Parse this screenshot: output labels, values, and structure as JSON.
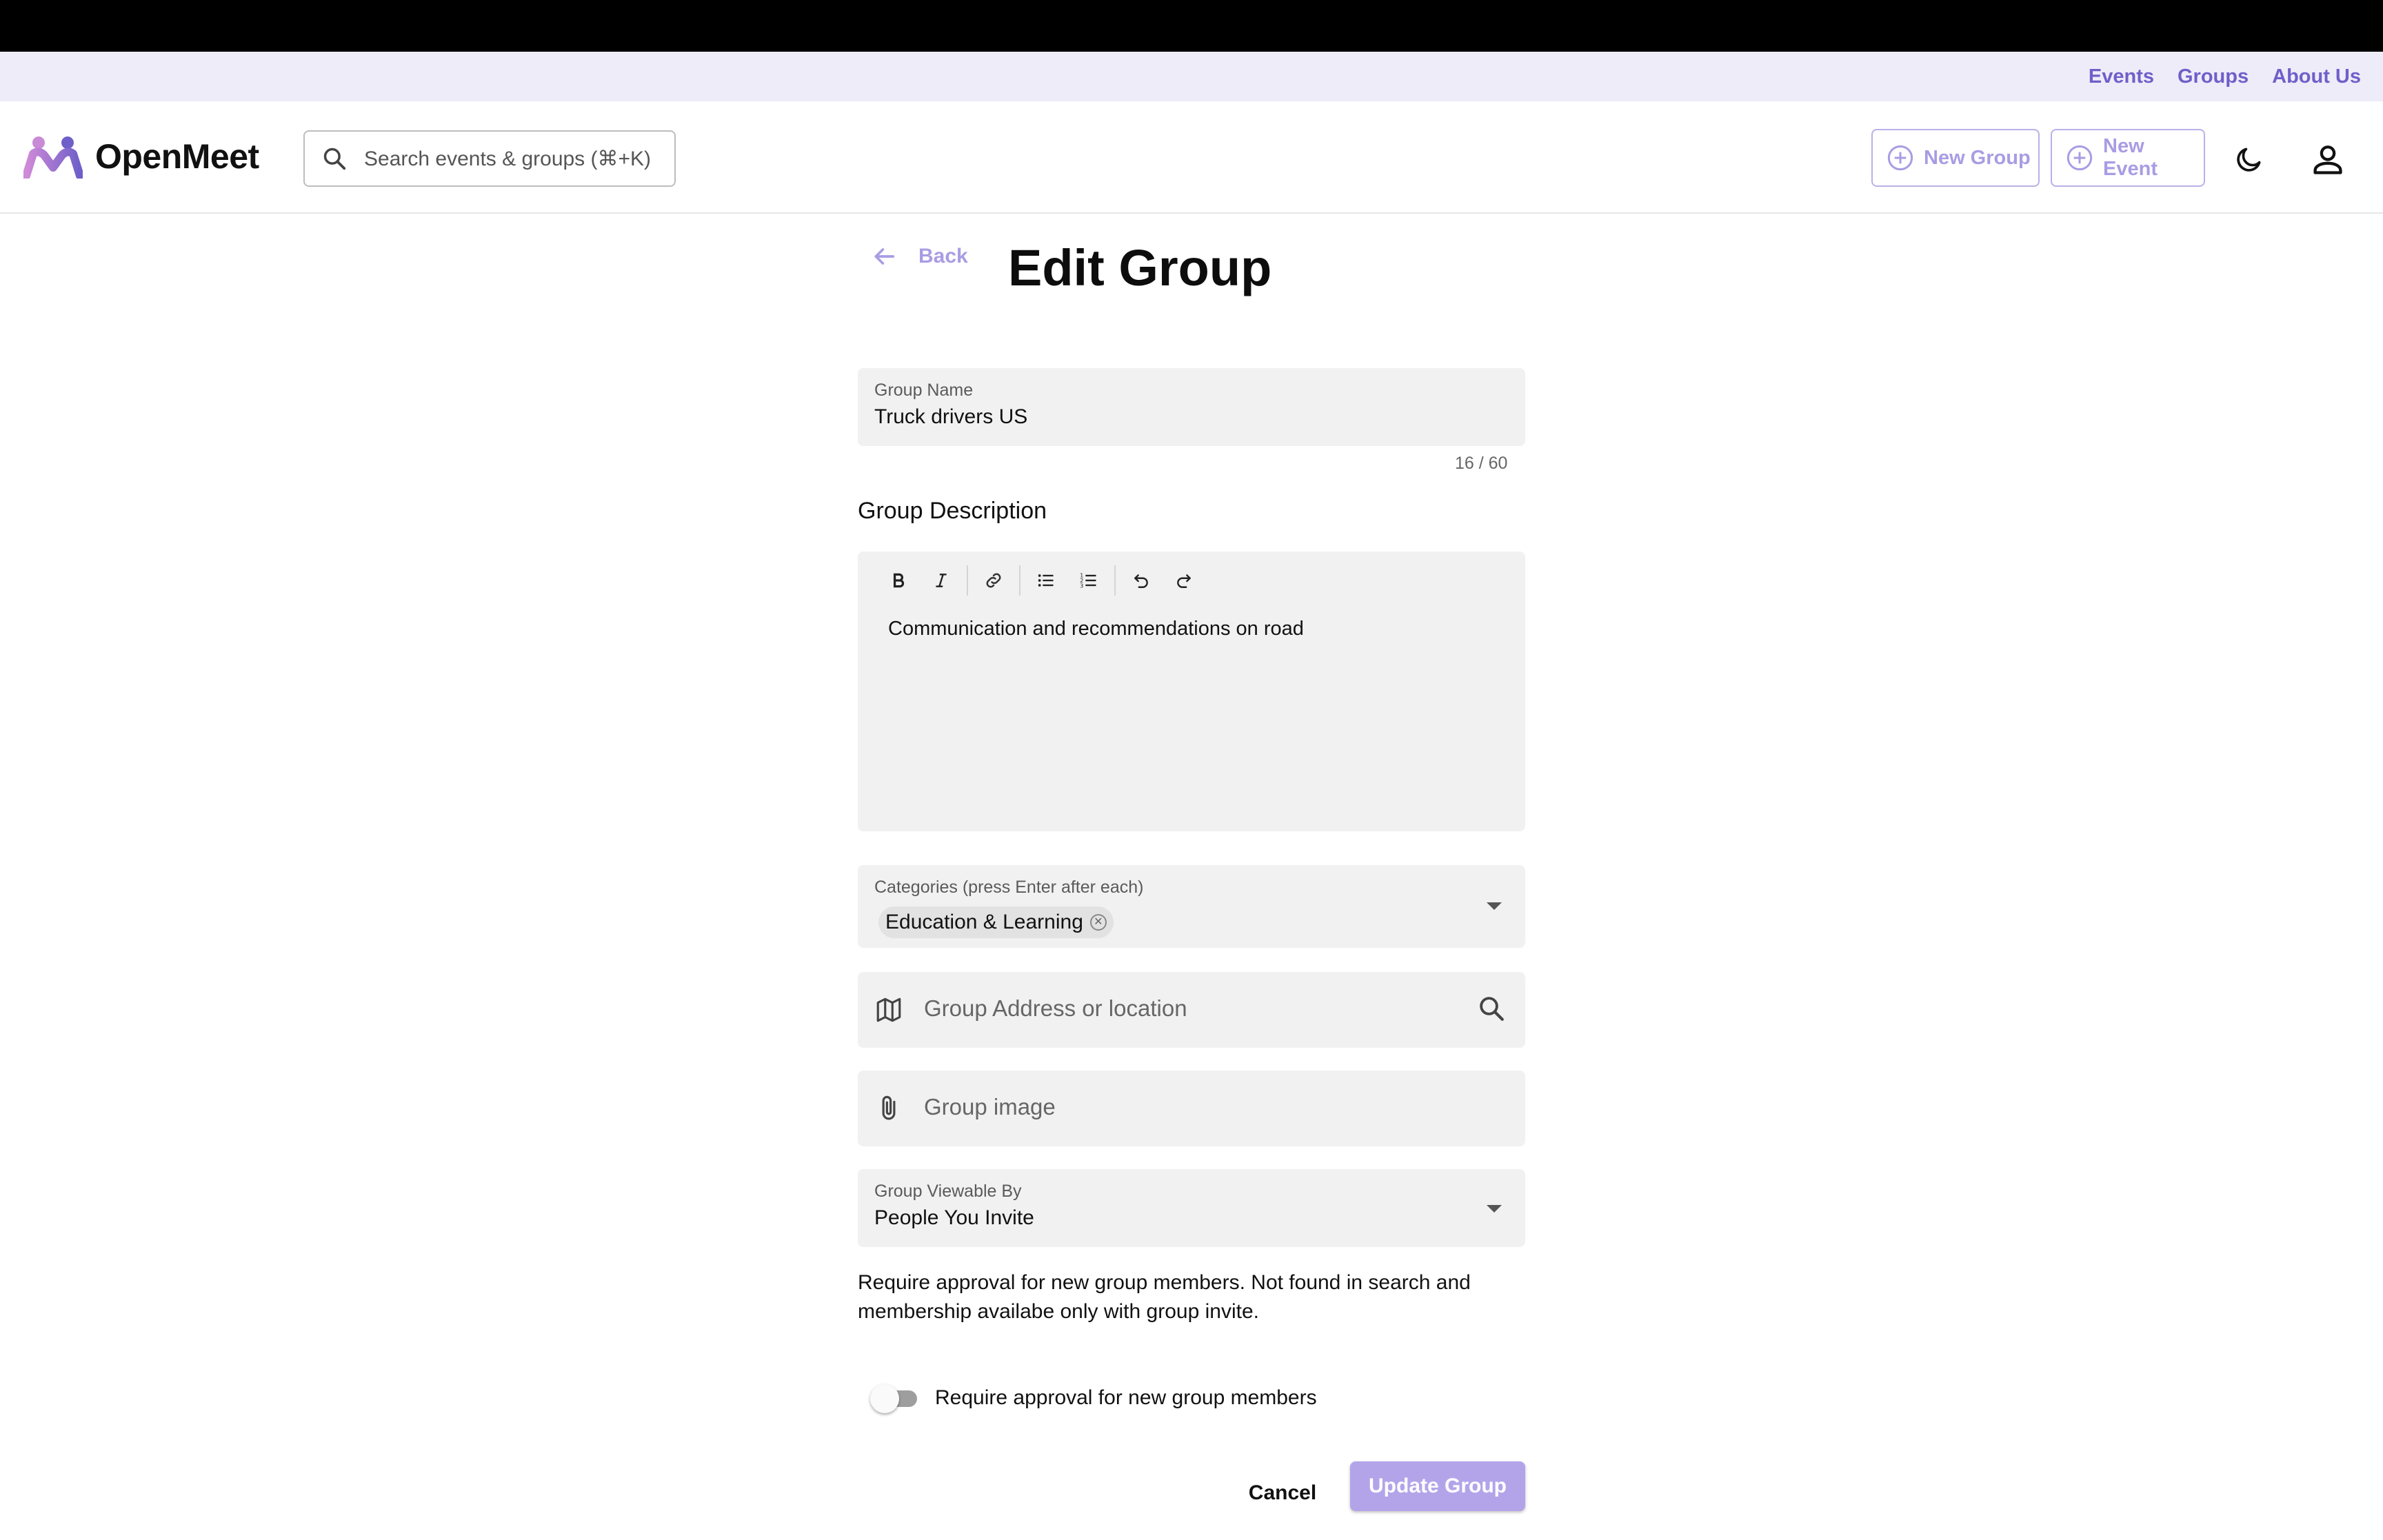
{
  "nav": {
    "links": [
      "Events",
      "Groups",
      "About Us"
    ]
  },
  "header": {
    "brand": "OpenMeet",
    "search_placeholder": "Search events & groups (⌘+K)",
    "new_group_label": "New Group",
    "new_event_label": "New Event",
    "icons": [
      "logo-icon",
      "search-icon",
      "plus-circle-icon",
      "moon-icon",
      "user-icon"
    ]
  },
  "colors": {
    "accent": "#6f5fc9",
    "accent_light": "#a99ce4",
    "subnav_bg": "#eeecf9",
    "field_bg": "#f1f1f1",
    "primary_button": "#b3a4ea"
  },
  "form": {
    "back_label": "Back",
    "title": "Edit Group",
    "group_name": {
      "label": "Group Name",
      "value": "Truck drivers US",
      "counter": "16 / 60"
    },
    "description": {
      "label": "Group Description",
      "toolbar": [
        "bold-icon",
        "italic-icon",
        "link-icon",
        "bullet-list-icon",
        "numbered-list-icon",
        "undo-icon",
        "redo-icon"
      ],
      "content": "Communication and recommendations on road"
    },
    "categories": {
      "label": "Categories (press Enter after each)",
      "selected": [
        "Education & Learning"
      ]
    },
    "location": {
      "placeholder": "Group Address or location"
    },
    "image": {
      "placeholder": "Group image"
    },
    "visibility": {
      "label": "Group Viewable By",
      "value": "People You Invite",
      "help": "Require approval for new group members. Not found in search and membership availabe only with group invite."
    },
    "approval_toggle": {
      "label": "Require approval for new group members",
      "on": false
    },
    "cancel_label": "Cancel",
    "submit_label": "Update Group"
  }
}
